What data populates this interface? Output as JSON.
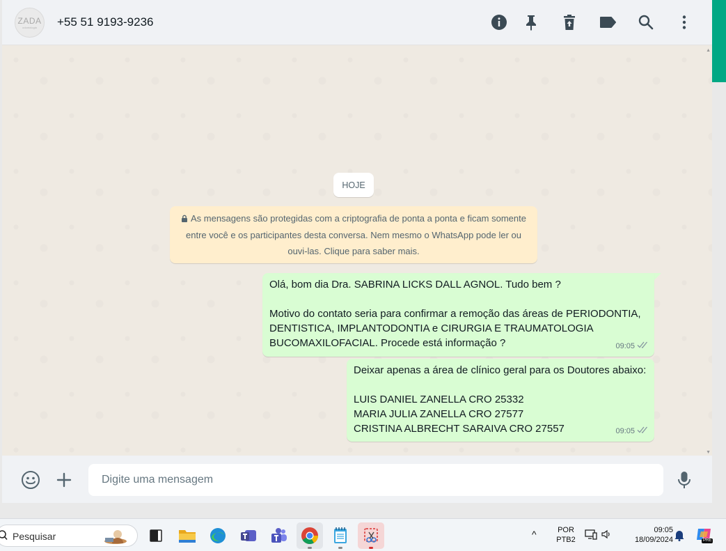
{
  "header": {
    "avatar_text": "ZADA",
    "avatar_subtext": "odontologia",
    "contact": "+55 51 9193-9236"
  },
  "chat": {
    "date_chip": "HOJE",
    "encryption_notice": "As mensagens são protegidas com a criptografia de ponta a ponta e ficam somente entre você e os participantes desta conversa. Nem mesmo o WhatsApp pode ler ou ouvi-las. Clique para saber mais.",
    "messages": [
      {
        "lines": [
          "Olá, bom dia Dra. SABRINA LICKS DALL AGNOL. Tudo bem ?",
          "",
          "Motivo do contato seria para confirmar a remoção das áreas de PERIODONTIA,",
          "DENTISTICA, IMPLANTODONTIA e CIRURGIA E TRAUMATOLOGIA",
          "BUCOMAXILOFACIAL. Procede está informação ?"
        ],
        "time": "09:05"
      },
      {
        "lines": [
          "Deixar apenas a área de clínico geral para os Doutores abaixo:",
          "",
          "LUIS DANIEL ZANELLA CRO 25332",
          "MARIA JULIA ZANELLA CRO 27577",
          "CRISTINA ALBRECHT SARAIVA CRO 27557"
        ],
        "time": "09:05"
      }
    ]
  },
  "composer": {
    "placeholder": "Digite uma mensagem"
  },
  "taskbar": {
    "search_placeholder": "Pesquisar",
    "language": "POR",
    "layout": "PTB2",
    "time": "09:05",
    "date": "18/09/2024",
    "copilot_badge": "PRE"
  },
  "colors": {
    "outgoing_bubble": "#d9fdd3",
    "accent": "#00a884",
    "encryption_bg": "#ffeecd"
  }
}
